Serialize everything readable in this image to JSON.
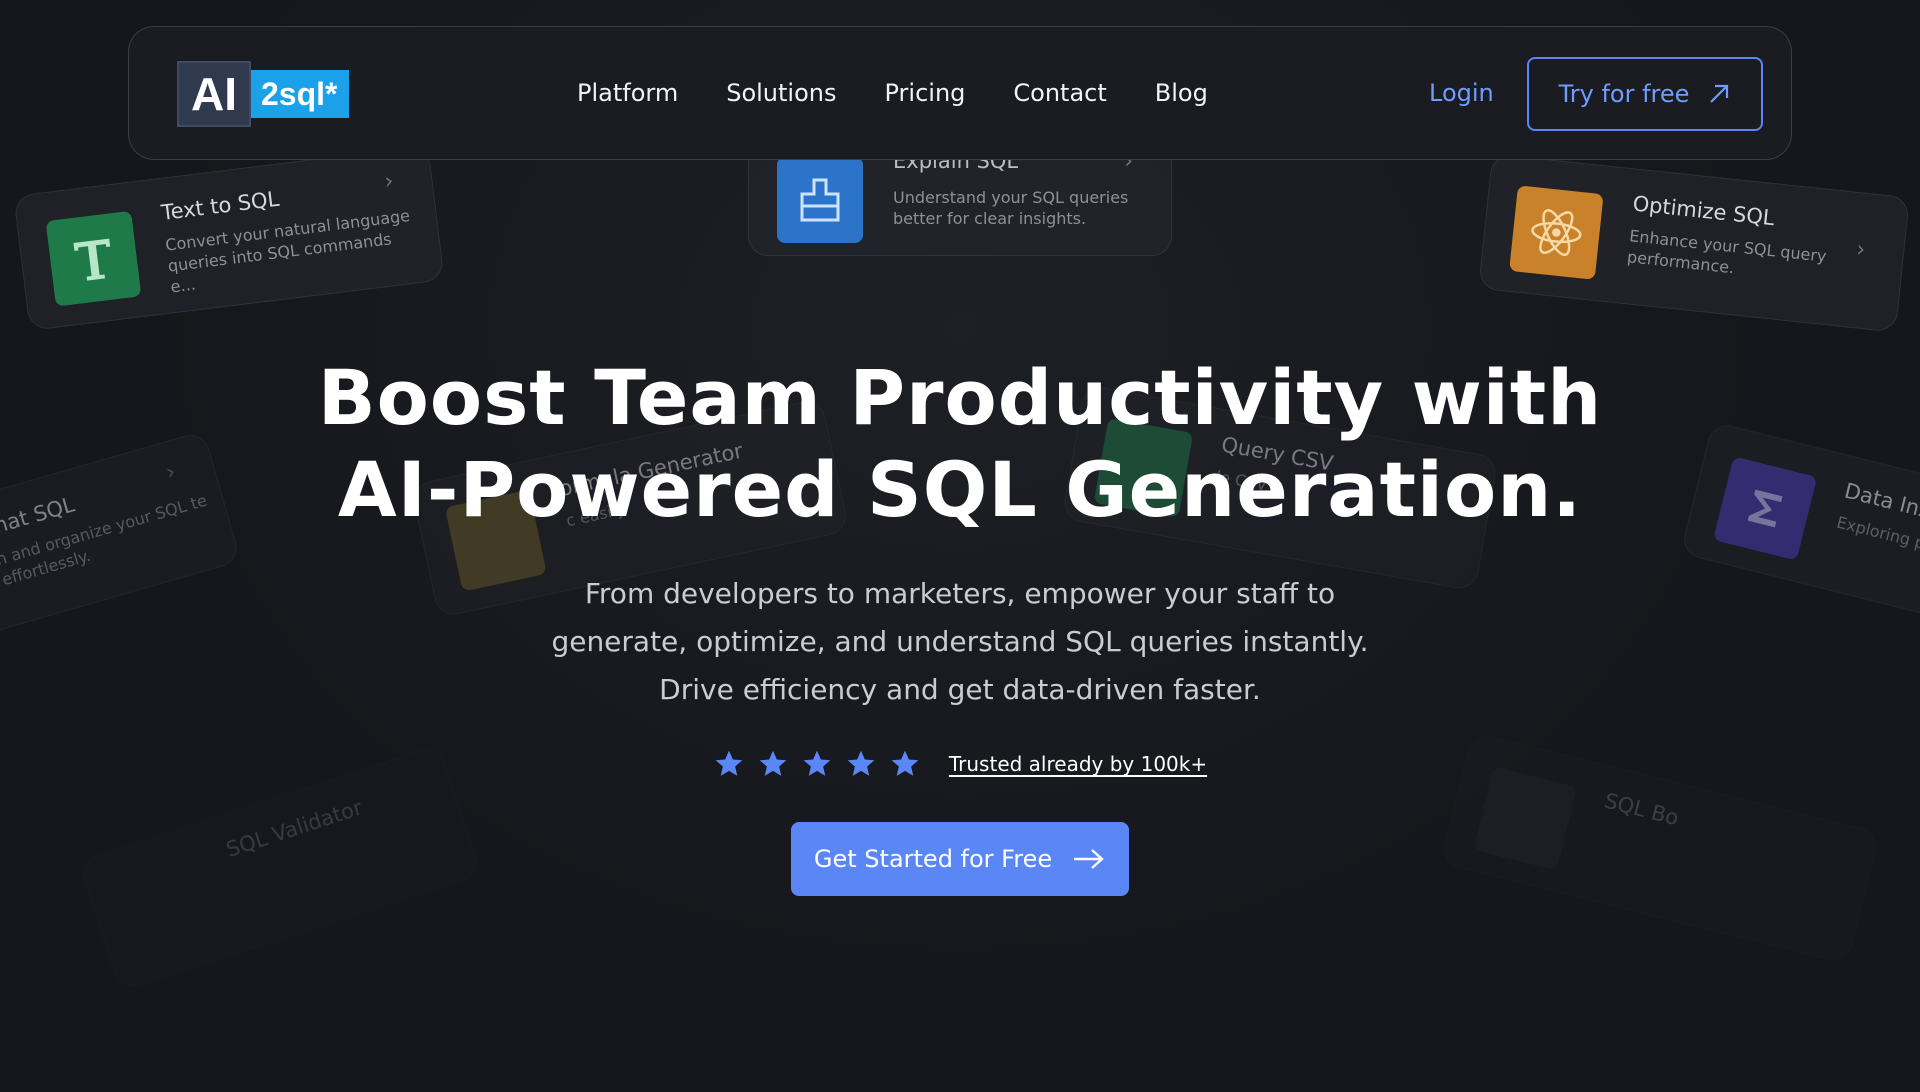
{
  "logo": {
    "ai_text": "AI",
    "sql_text": "2sql*"
  },
  "nav": {
    "items": [
      "Platform",
      "Solutions",
      "Pricing",
      "Contact",
      "Blog"
    ],
    "login_label": "Login",
    "try_label": "Try for free"
  },
  "cards": {
    "text_to_sql": {
      "title": "Text to SQL",
      "desc": "Convert your natural language queries into SQL commands e...",
      "icon": "letter-t-icon"
    },
    "explain_sql": {
      "title": "Explain SQL",
      "desc": "Understand your SQL queries better for clear insights.",
      "icon": "brush-icon"
    },
    "optimize_sql": {
      "title": "Optimize SQL",
      "desc": "Enhance your SQL query performance.",
      "icon": "atom-icon"
    },
    "format_sql": {
      "title": "mat SQL",
      "desc": "n and organize your SQL te effortlessly."
    },
    "formula_generator": {
      "title": "ormula Generator",
      "desc": "c easily"
    },
    "query_csv": {
      "title": "Query CSV",
      "desc": "le CSV"
    },
    "data_insights": {
      "title": "Data Insi",
      "desc": "Exploring po analysis for y",
      "icon": "sigma-icon"
    },
    "sql_validator": {
      "title": "SQL Validator"
    },
    "sql_bot": {
      "title": "SQL Bo"
    }
  },
  "hero": {
    "title_line1": "Boost Team Productivity with",
    "title_line2": "AI-Powered SQL Generation.",
    "sub_line1": "From developers to marketers, empower your staff to",
    "sub_line2": "generate, optimize, and understand SQL queries instantly.",
    "sub_line3": "Drive efficiency and get data-driven faster.",
    "rating_stars": 5,
    "trusted_label": "Trusted already by 100k+",
    "cta_label": "Get Started for Free"
  },
  "colors": {
    "background": "#15171c",
    "accent": "#5b86f5",
    "link": "#6f9cff",
    "logo_blue": "#1aa1ea"
  }
}
